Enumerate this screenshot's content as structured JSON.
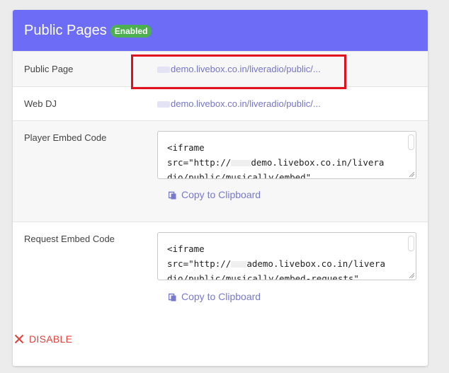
{
  "header": {
    "title": "Public Pages",
    "status_badge": "Enabled"
  },
  "rows": {
    "public_page": {
      "label": "Public Page",
      "link_text": "demo.livebox.co.in/liveradio/public/..."
    },
    "web_dj": {
      "label": "Web DJ",
      "link_text": "demo.livebox.co.in/liveradio/public/..."
    },
    "player_embed": {
      "label": "Player Embed Code",
      "code_line1": "<iframe",
      "code_line2_prefix": "src=\"http://",
      "code_line2_suffix": "demo.livebox.co.in/livera",
      "code_line3": "dio/public/musically/embed\"",
      "copy_label": "Copy to Clipboard"
    },
    "request_embed": {
      "label": "Request Embed Code",
      "code_line1": "<iframe",
      "code_line2_prefix": "src=\"http://",
      "code_line2_suffix": "ademo.livebox.co.in/livera",
      "code_line3": "dio/public/musically/embed-requests\"",
      "copy_label": "Copy to Clipboard"
    }
  },
  "footer": {
    "disable_label": "DISABLE"
  },
  "colors": {
    "header_bg": "#6d6cf7",
    "badge_bg": "#4caf50",
    "link": "#7575c8",
    "disable": "#e5403a",
    "highlight": "#e0101c"
  },
  "icons": {
    "copy": "copy-icon",
    "disable": "close-icon"
  }
}
